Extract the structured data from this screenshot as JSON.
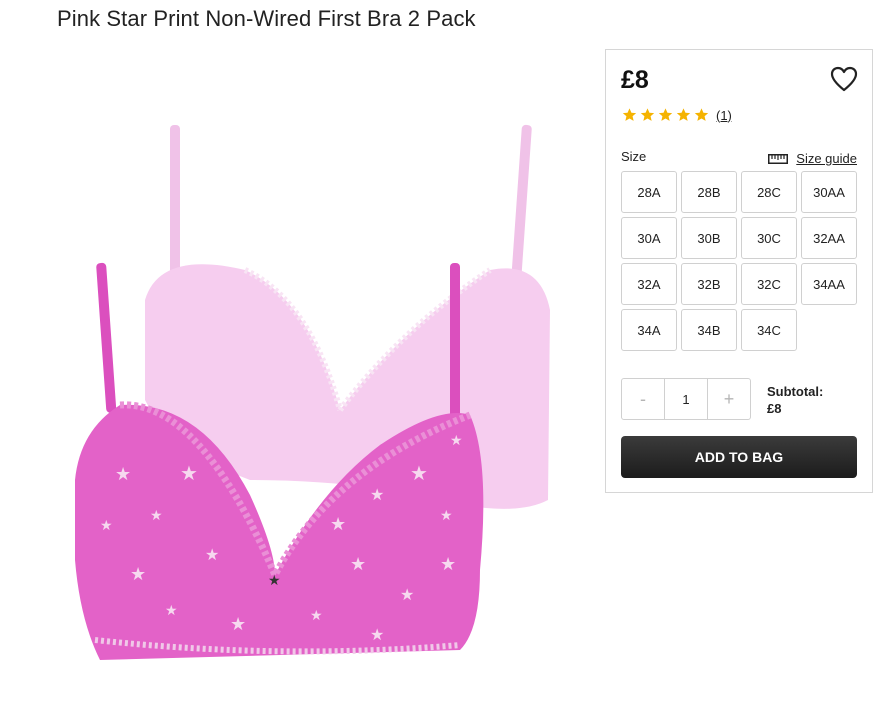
{
  "product": {
    "title": "Pink Star Print Non-Wired First Bra 2 Pack",
    "image_icon": "product-photo-two-pink-bras",
    "price": "£8",
    "rating": {
      "stars": 5,
      "count_label": "(1)"
    }
  },
  "size_selector": {
    "label": "Size",
    "guide_label": "Size guide",
    "guide_icon": "ruler-icon",
    "sizes": [
      "28A",
      "28B",
      "28C",
      "30AA",
      "30A",
      "30B",
      "30C",
      "32AA",
      "32A",
      "32B",
      "32C",
      "34AA",
      "34A",
      "34B",
      "34C"
    ]
  },
  "quantity": {
    "minus": "-",
    "value": "1",
    "plus": "+"
  },
  "subtotal": {
    "label": "Subtotal:",
    "value": "£8"
  },
  "cta": {
    "add_to_bag": "ADD TO BAG"
  },
  "colors": {
    "star_rating": "#f5b301",
    "button_dark": "#222222",
    "bra_front": "#e25fc6",
    "bra_back": "#f3c6ea"
  }
}
